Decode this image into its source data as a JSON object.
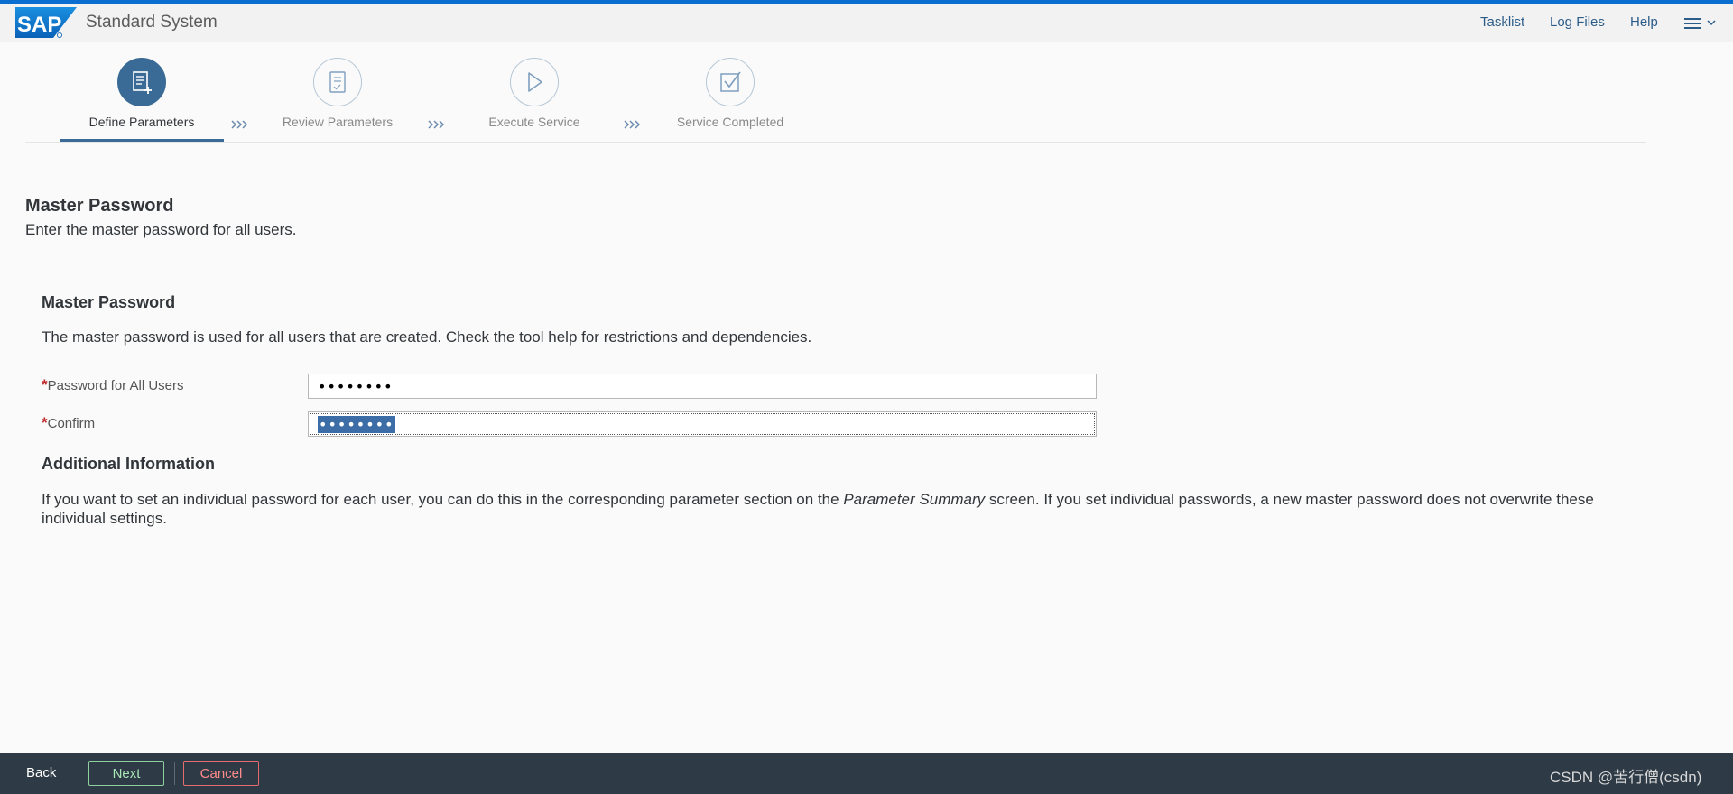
{
  "shell": {
    "logo_text": "SAP",
    "title": "Standard System",
    "links": [
      "Tasklist",
      "Log Files",
      "Help"
    ],
    "menu_icon": "hamburger-menu-icon"
  },
  "wizard": {
    "steps": [
      {
        "label": "Define Parameters",
        "icon": "define-parameters-icon",
        "active": true
      },
      {
        "label": "Review Parameters",
        "icon": "review-parameters-icon",
        "active": false
      },
      {
        "label": "Execute Service",
        "icon": "play-icon",
        "active": false
      },
      {
        "label": "Service Completed",
        "icon": "checkbox-checked-icon",
        "active": false
      }
    ]
  },
  "page": {
    "title": "Master Password",
    "subtitle": "Enter the master password for all users."
  },
  "section": {
    "title": "Master Password",
    "description": "The master password is used for all users that are created. Check the tool help for restrictions and dependencies.",
    "fields": [
      {
        "label": "Password for All Users",
        "required": "*",
        "value": "••••••••"
      },
      {
        "label": "Confirm",
        "required": "*",
        "value": "••••••••"
      }
    ]
  },
  "additional": {
    "title": "Additional Information",
    "text_before": "If you want to set an individual password for each user, you can do this in the corresponding parameter section on the ",
    "text_emphasis": "Parameter Summary",
    "text_after": " screen. If you set individual passwords, a new master password does not overwrite these individual settings."
  },
  "footer": {
    "back": "Back",
    "next": "Next",
    "cancel": "Cancel",
    "watermark": "CSDN @苦行僧(csdn)"
  },
  "colors": {
    "accent": "#3a6b96",
    "topline": "#0a6ed1",
    "footer_bg": "#2e3b47",
    "required": "#c0282a"
  }
}
